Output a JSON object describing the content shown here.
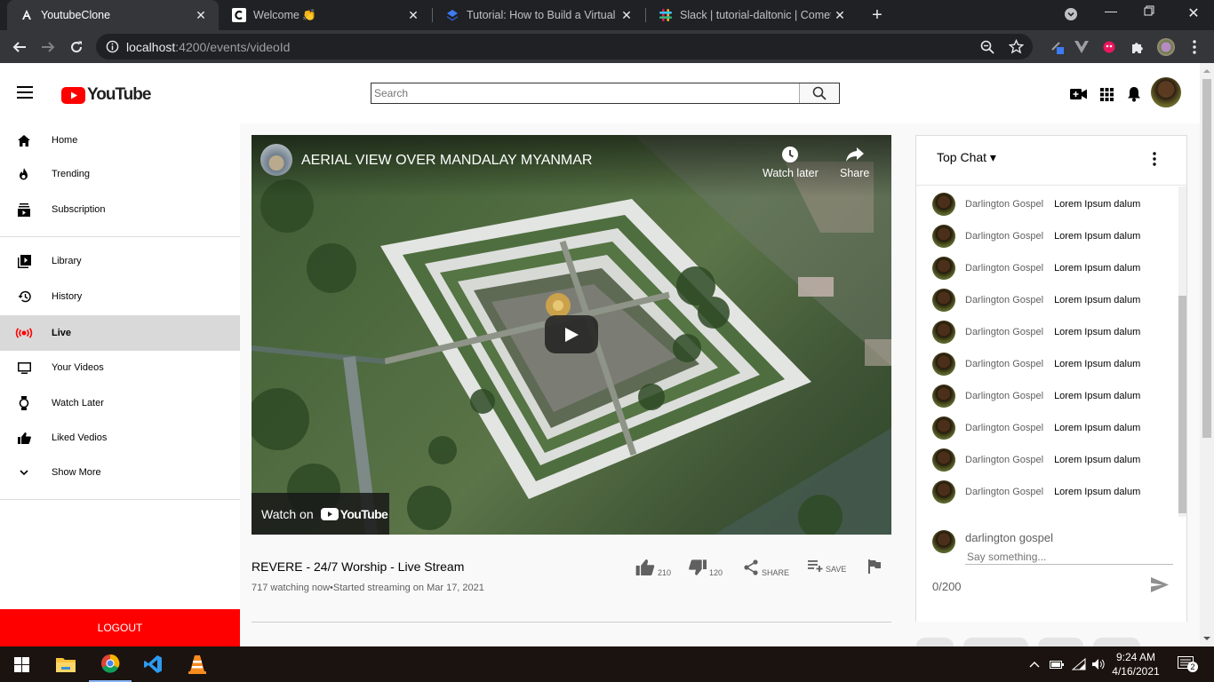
{
  "browser": {
    "tabs": [
      {
        "title": "YoutubeClone",
        "active": true,
        "icon": "angular-icon"
      },
      {
        "title": "Welcome 👏",
        "active": false,
        "icon": "cometchat-icon"
      },
      {
        "title": "Tutorial: How to Build a Virtual E",
        "active": false,
        "icon": "dropbox-paper-icon"
      },
      {
        "title": "Slack | tutorial-daltonic | CometC",
        "active": false,
        "icon": "slack-icon"
      }
    ],
    "url_host": "localhost",
    "url_rest": ":4200/events/videoId"
  },
  "masthead": {
    "logo_text": "YouTube",
    "search_placeholder": "Search"
  },
  "sidebar": {
    "items": [
      {
        "label": "Home",
        "icon": "home-icon"
      },
      {
        "label": "Trending",
        "icon": "fire-icon"
      },
      {
        "label": "Subscription",
        "icon": "subscriptions-icon"
      },
      {
        "label": "Library",
        "icon": "library-icon"
      },
      {
        "label": "History",
        "icon": "history-icon"
      },
      {
        "label": "Live",
        "icon": "live-icon",
        "active": true
      },
      {
        "label": "Your Videos",
        "icon": "monitor-icon"
      },
      {
        "label": "Watch Later",
        "icon": "watch-icon"
      },
      {
        "label": "Liked Vedios",
        "icon": "thumb-up-icon"
      },
      {
        "label": "Show More",
        "icon": "chevron-down-icon"
      }
    ],
    "logout_label": "LOGOUT"
  },
  "player": {
    "video_title": "AERIAL VIEW OVER MANDALAY MYANMAR",
    "watch_later": "Watch later",
    "share": "Share",
    "watch_on": "Watch on",
    "watch_on_brand": "YouTube"
  },
  "video": {
    "title": "REVERE - 24/7 Worship - Live Stream",
    "meta": "717 watching now•Started streaming on Mar 17, 2021",
    "likes": "210",
    "dislikes": "120",
    "share_label": "SHARE",
    "save_label": "SAVE"
  },
  "chat": {
    "header": "Top Chat ▾",
    "messages": [
      {
        "author": "Darlington Gospel",
        "text": "Lorem Ipsum dalum"
      },
      {
        "author": "Darlington Gospel",
        "text": "Lorem Ipsum dalum"
      },
      {
        "author": "Darlington Gospel",
        "text": "Lorem Ipsum dalum"
      },
      {
        "author": "Darlington Gospel",
        "text": "Lorem Ipsum dalum"
      },
      {
        "author": "Darlington Gospel",
        "text": "Lorem Ipsum dalum"
      },
      {
        "author": "Darlington Gospel",
        "text": "Lorem Ipsum dalum"
      },
      {
        "author": "Darlington Gospel",
        "text": "Lorem Ipsum dalum"
      },
      {
        "author": "Darlington Gospel",
        "text": "Lorem Ipsum dalum"
      },
      {
        "author": "Darlington Gospel",
        "text": "Lorem Ipsum dalum"
      },
      {
        "author": "Darlington Gospel",
        "text": "Lorem Ipsum dalum"
      }
    ],
    "input_user": "darlington gospel",
    "input_placeholder": "Say something...",
    "char_count": "0/200"
  },
  "taskbar": {
    "time": "9:24 AM",
    "date": "4/16/2021",
    "notifications": "2"
  },
  "colors": {
    "youtube_red": "#ff0000",
    "chrome_dark": "#202124",
    "chrome_toolbar": "#35363a"
  }
}
